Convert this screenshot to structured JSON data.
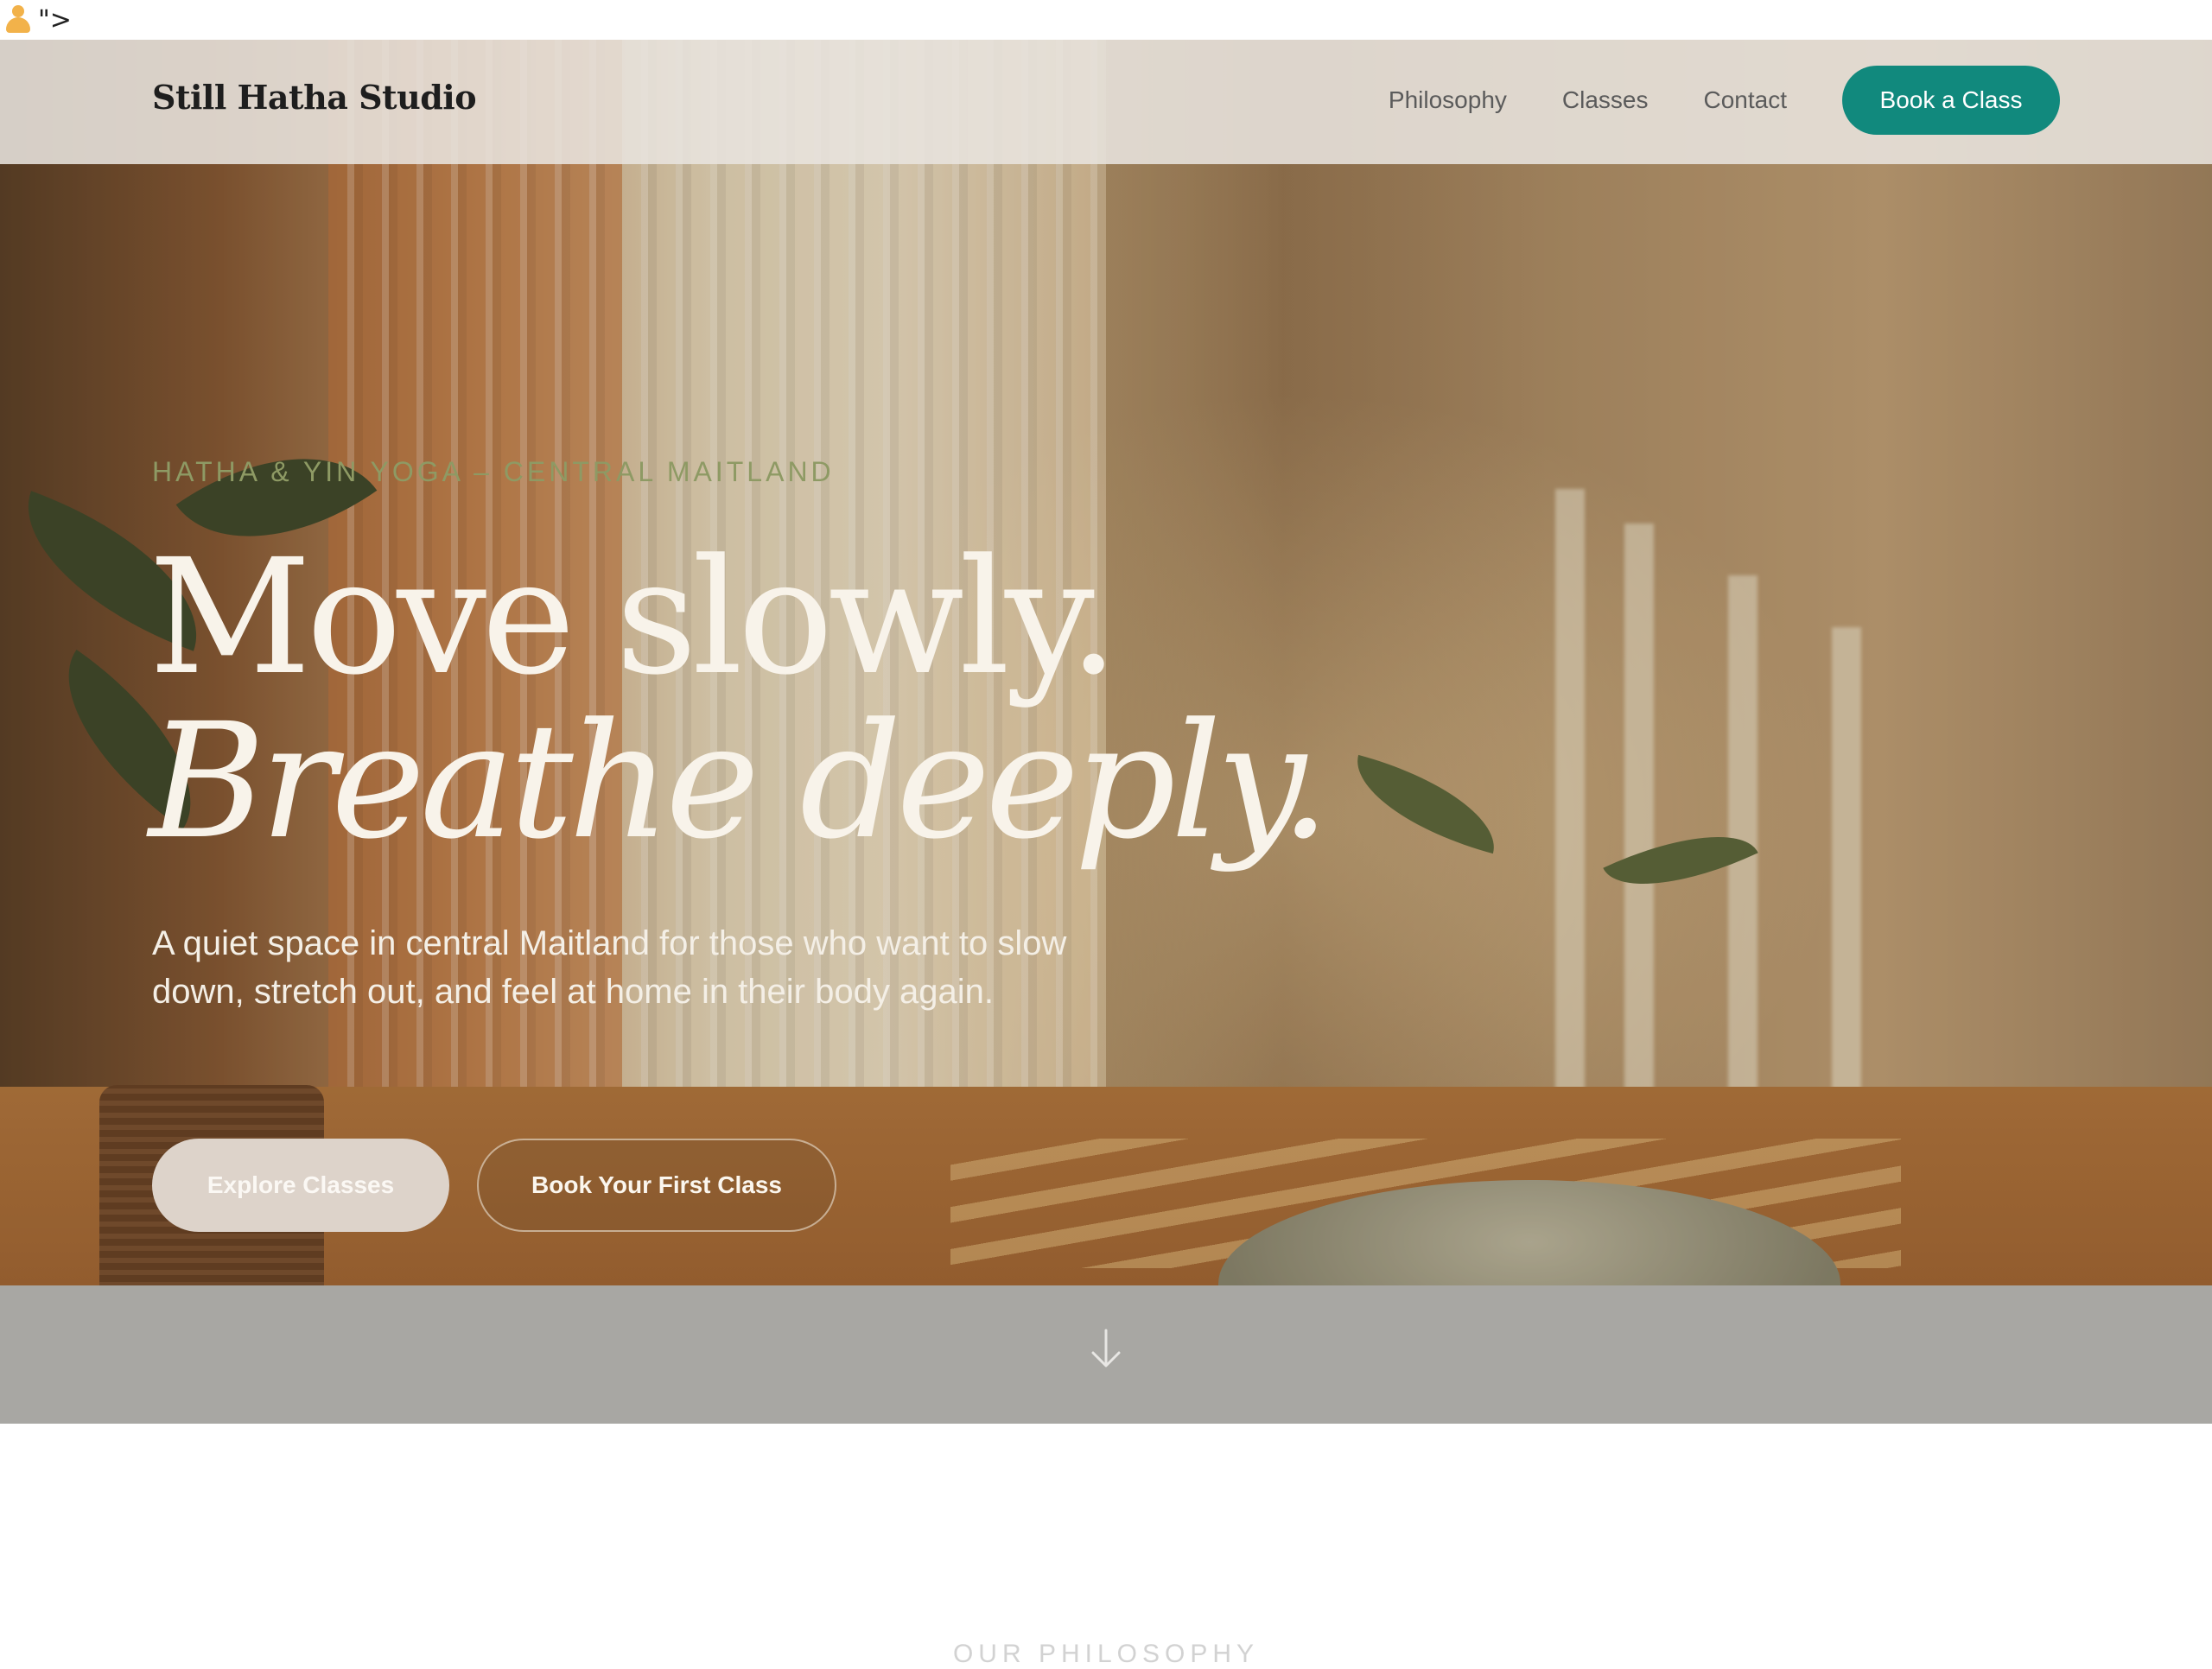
{
  "artifact": {
    "text": "\">"
  },
  "nav": {
    "logo": "Still Hatha Studio",
    "links": [
      "Philosophy",
      "Classes",
      "Contact"
    ],
    "cta": "Book a Class"
  },
  "hero": {
    "eyebrow": "HATHA & YIN YOGA – CENTRAL MAITLAND",
    "headline_line1": "Move slowly.",
    "headline_line2": "Breathe deeply.",
    "lede": "A quiet space in central Maitland for those who want to slow down, stretch out, and feel at home in their body again.",
    "buttons": {
      "explore": "Explore Classes",
      "book": "Book Your First Class"
    }
  },
  "scroll": {
    "icon": "arrow-down-icon"
  },
  "philosophy": {
    "label": "OUR PHILOSOPHY"
  },
  "colors": {
    "accent": "#11897d",
    "eyebrow": "#8e9a64",
    "nav_bg": "#e8e4de"
  }
}
